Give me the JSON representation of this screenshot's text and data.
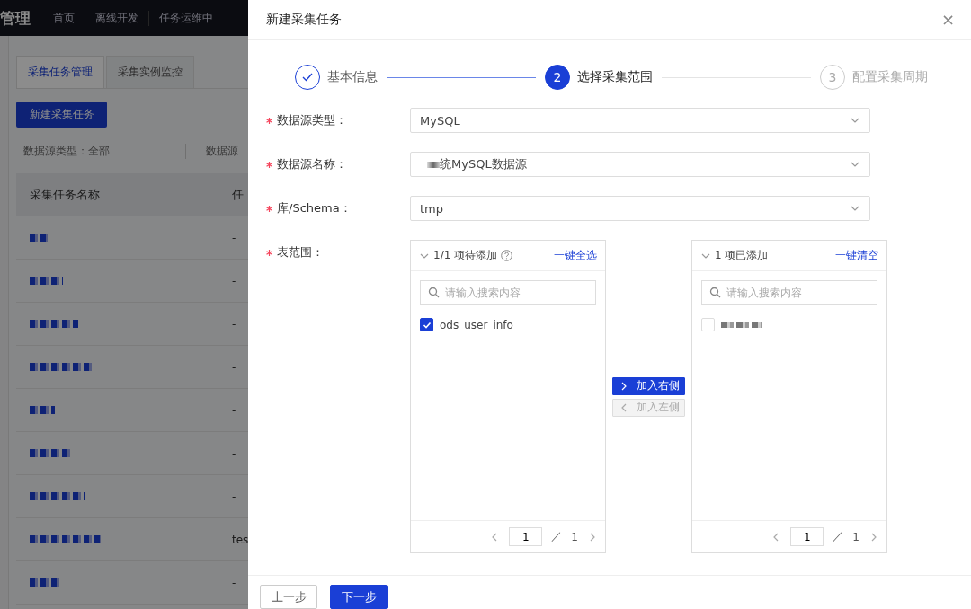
{
  "topbar": {
    "brand": "管理",
    "nav": [
      {
        "label": "首页",
        "selected": false
      },
      {
        "label": "离线开发",
        "selected": false
      },
      {
        "label": "任务运维中",
        "selected": false
      }
    ]
  },
  "page": {
    "tabs": [
      {
        "label": "采集任务管理",
        "selected": true
      },
      {
        "label": "采集实例监控",
        "selected": false
      }
    ],
    "new_button": "新建采集任务",
    "filters": [
      "数据源类型：全部",
      "数据源"
    ],
    "table": {
      "columns": [
        "采集任务名称",
        "任"
      ],
      "rows": [
        {
          "name_masked": true,
          "column_2": "-"
        },
        {
          "name_masked": true,
          "column_2": "-"
        },
        {
          "name_masked": true,
          "column_2": "-"
        },
        {
          "name_masked": true,
          "column_2": "-"
        },
        {
          "name_masked": true,
          "column_2": "-"
        },
        {
          "name_masked": true,
          "column_2": "-"
        },
        {
          "name_masked": true,
          "column_2": "-"
        },
        {
          "name_masked": true,
          "column_2": "tes"
        },
        {
          "name_masked": true,
          "column_2": "-"
        }
      ]
    }
  },
  "drawer": {
    "title": "新建采集任务",
    "close": "×",
    "steps": [
      {
        "label": "基本信息",
        "completed": true,
        "selected": false
      },
      {
        "number": "2",
        "label": "选择采集范围",
        "completed": false,
        "selected": true
      },
      {
        "number": "3",
        "label": "配置采集周期",
        "completed": false,
        "selected": false
      }
    ],
    "fields": [
      {
        "label": "数据源类型：",
        "required": true,
        "value": "MySQL",
        "masked_prefix": false
      },
      {
        "label": "数据源名称：",
        "required": true,
        "value": "统MySQL数据源",
        "masked_prefix": true
      },
      {
        "label": "库/Schema：",
        "required": true,
        "value": "tmp",
        "masked_prefix": false
      }
    ],
    "transfer": {
      "label": "表范围：",
      "required": true,
      "left": {
        "title": "1/1 项待添加",
        "action": "一键全选",
        "placeholder": "请输入搜索内容",
        "items": [
          {
            "label": "ods_user_info",
            "masked": false,
            "checked": true
          }
        ],
        "page": "1",
        "separator": "／",
        "total": "1"
      },
      "right": {
        "title": "1 项已添加",
        "action": "一键清空",
        "placeholder": "请输入搜索内容",
        "items": [
          {
            "masked": true,
            "checked": false
          }
        ],
        "page": "1",
        "separator": "／",
        "total": "1"
      },
      "to_right": {
        "label": "加入右侧",
        "disabled": false
      },
      "to_left": {
        "label": "加入左侧",
        "disabled": true
      }
    },
    "footer": [
      {
        "label": "上一步",
        "kind": "secondary"
      },
      {
        "label": "下一步",
        "kind": "primary"
      }
    ]
  }
}
